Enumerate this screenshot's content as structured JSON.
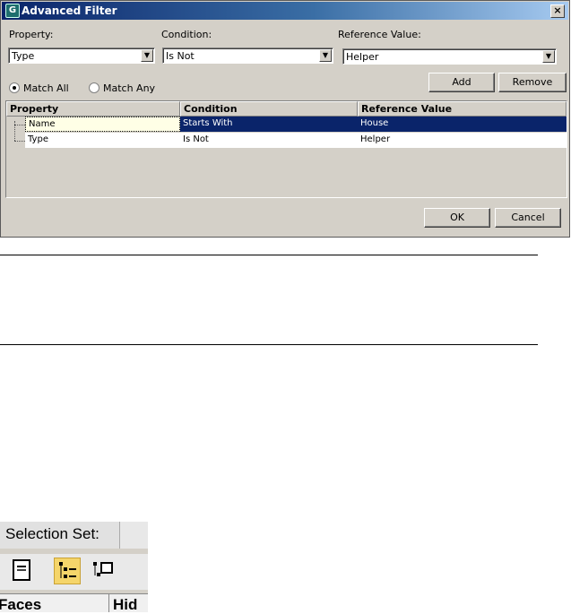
{
  "dialog": {
    "title": "Advanced Filter",
    "close_glyph": "×",
    "property_label": "Property:",
    "condition_label": "Condition:",
    "reference_label": "Reference Value:",
    "property_value": "Type",
    "condition_value": "Is Not",
    "reference_value": "Helper",
    "match_all": "Match All",
    "match_any": "Match Any",
    "match_all_selected": true,
    "add_button": "Add",
    "remove_button": "Remove",
    "ok_button": "OK",
    "cancel_button": "Cancel",
    "columns": [
      "Property",
      "Condition",
      "Reference Value"
    ],
    "rows": [
      {
        "property": "Name",
        "condition": "Starts With",
        "reference": "House",
        "selected": true
      },
      {
        "property": "Type",
        "condition": "Is Not",
        "reference": "Helper",
        "selected": false
      }
    ],
    "colors": {
      "title_start": "#0a246a",
      "title_end": "#a6caf0",
      "selection": "#0a246a",
      "face": "#d4d0c8"
    }
  },
  "snippet": {
    "selection_set_label": "Selection Set:",
    "col_faces": "Faces",
    "col_hide": "Hid",
    "icons": [
      "document-icon",
      "tree-list-icon",
      "tree-select-icon"
    ]
  }
}
